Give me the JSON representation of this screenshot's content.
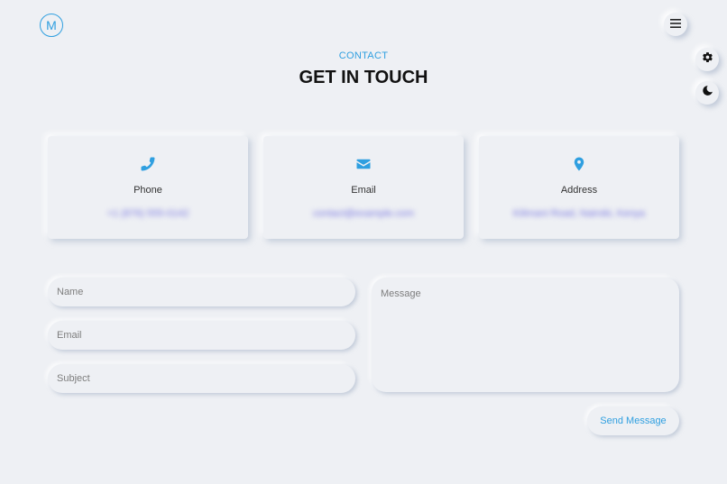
{
  "header": {
    "logo_letter": "M"
  },
  "section": {
    "eyebrow": "CONTACT",
    "title": "GET IN TOUCH"
  },
  "cards": [
    {
      "icon": "phone-icon",
      "label": "Phone",
      "value": "+1 (876) 555-0142"
    },
    {
      "icon": "envelope-icon",
      "label": "Email",
      "value": "contact@example.com"
    },
    {
      "icon": "map-pin-icon",
      "label": "Address",
      "value": "Kilimani Road, Nairobi, Kenya"
    }
  ],
  "form": {
    "name_placeholder": "Name",
    "email_placeholder": "Email",
    "subject_placeholder": "Subject",
    "message_placeholder": "Message",
    "send_label": "Send Message"
  },
  "colors": {
    "accent": "#2f9fe0",
    "background": "#eef0f4"
  }
}
